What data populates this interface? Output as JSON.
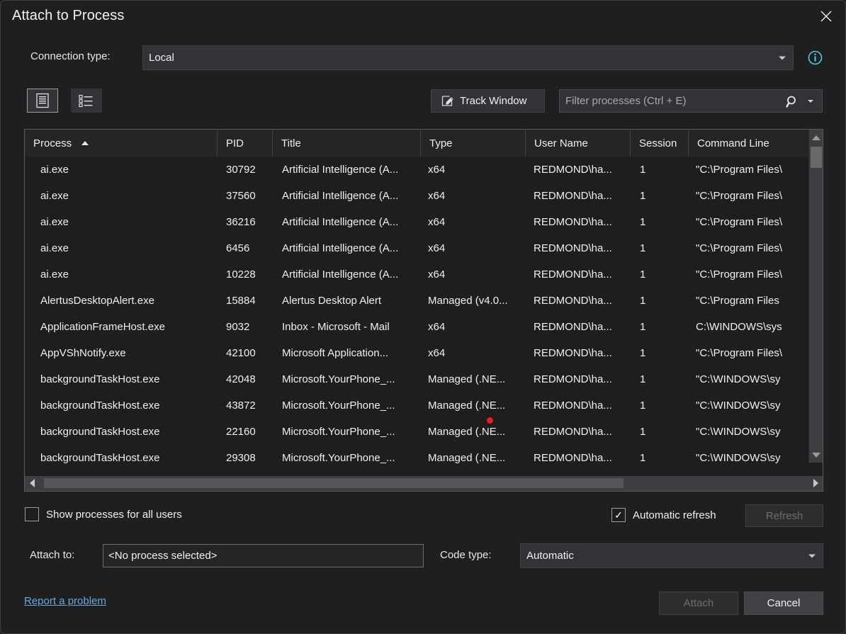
{
  "window": {
    "title": "Attach to Process",
    "close_icon": "close-icon"
  },
  "connection": {
    "label": "Connection type:",
    "value": "Local",
    "info_icon": "info-icon"
  },
  "toolbar": {
    "details_view_icon": "details-view-icon",
    "list_view_icon": "list-view-icon",
    "track_window_label": "Track Window",
    "track_window_icon": "track-window-icon",
    "filter_placeholder": "Filter processes (Ctrl + E)",
    "filter_value": "",
    "search_icon": "search-icon",
    "filter_dropdown_icon": "chevron-down-icon"
  },
  "grid": {
    "columns": [
      {
        "label": "Process",
        "sorted": "asc"
      },
      {
        "label": "PID",
        "sorted": ""
      },
      {
        "label": "Title",
        "sorted": ""
      },
      {
        "label": "Type",
        "sorted": ""
      },
      {
        "label": "User Name",
        "sorted": ""
      },
      {
        "label": "Session",
        "sorted": ""
      },
      {
        "label": "Command Line",
        "sorted": ""
      }
    ],
    "rows": [
      {
        "process": "ai.exe",
        "pid": "30792",
        "title": "Artificial Intelligence (A...",
        "type": "x64",
        "user": "REDMOND\\ha...",
        "session": "1",
        "cmd": "\"C:\\Program Files\\"
      },
      {
        "process": "ai.exe",
        "pid": "37560",
        "title": "Artificial Intelligence (A...",
        "type": "x64",
        "user": "REDMOND\\ha...",
        "session": "1",
        "cmd": "\"C:\\Program Files\\"
      },
      {
        "process": "ai.exe",
        "pid": "36216",
        "title": "Artificial Intelligence (A...",
        "type": "x64",
        "user": "REDMOND\\ha...",
        "session": "1",
        "cmd": "\"C:\\Program Files\\"
      },
      {
        "process": "ai.exe",
        "pid": "6456",
        "title": "Artificial Intelligence (A...",
        "type": "x64",
        "user": "REDMOND\\ha...",
        "session": "1",
        "cmd": "\"C:\\Program Files\\"
      },
      {
        "process": "ai.exe",
        "pid": "10228",
        "title": "Artificial Intelligence (A...",
        "type": "x64",
        "user": "REDMOND\\ha...",
        "session": "1",
        "cmd": "\"C:\\Program Files\\"
      },
      {
        "process": "AlertusDesktopAlert.exe",
        "pid": "15884",
        "title": "Alertus Desktop Alert",
        "type": "Managed (v4.0...",
        "user": "REDMOND\\ha...",
        "session": "1",
        "cmd": "\"C:\\Program Files"
      },
      {
        "process": "ApplicationFrameHost.exe",
        "pid": "9032",
        "title": "Inbox - Microsoft - Mail",
        "type": "x64",
        "user": "REDMOND\\ha...",
        "session": "1",
        "cmd": "C:\\WINDOWS\\sys"
      },
      {
        "process": "AppVShNotify.exe",
        "pid": "42100",
        "title": "Microsoft Application...",
        "type": "x64",
        "user": "REDMOND\\ha...",
        "session": "1",
        "cmd": "\"C:\\Program Files\\"
      },
      {
        "process": "backgroundTaskHost.exe",
        "pid": "42048",
        "title": "Microsoft.YourPhone_...",
        "type": "Managed (.NE...",
        "user": "REDMOND\\ha...",
        "session": "1",
        "cmd": "\"C:\\WINDOWS\\sy"
      },
      {
        "process": "backgroundTaskHost.exe",
        "pid": "43872",
        "title": "Microsoft.YourPhone_...",
        "type": "Managed (.NE...",
        "user": "REDMOND\\ha...",
        "session": "1",
        "cmd": "\"C:\\WINDOWS\\sy"
      },
      {
        "process": "backgroundTaskHost.exe",
        "pid": "22160",
        "title": "Microsoft.YourPhone_...",
        "type": "Managed (.NE...",
        "user": "REDMOND\\ha...",
        "session": "1",
        "cmd": "\"C:\\WINDOWS\\sy"
      },
      {
        "process": "backgroundTaskHost.exe",
        "pid": "29308",
        "title": "Microsoft.YourPhone_...",
        "type": "Managed (.NE...",
        "user": "REDMOND\\ha...",
        "session": "1",
        "cmd": "\"C:\\WINDOWS\\sy"
      }
    ],
    "vscroll_up_icon": "scroll-up-icon",
    "vscroll_down_icon": "scroll-down-icon",
    "hscroll_left_icon": "scroll-left-icon",
    "hscroll_right_icon": "scroll-right-icon"
  },
  "options": {
    "show_all_users_label": "Show processes for all users",
    "show_all_users_checked": false,
    "show_all_users_mark": "",
    "automatic_refresh_label": "Automatic refresh",
    "automatic_refresh_checked": true,
    "automatic_refresh_mark": "✓",
    "refresh_label": "Refresh"
  },
  "attach": {
    "label": "Attach to:",
    "value": "<No process selected>",
    "code_type_label": "Code type:",
    "code_type_value": "Automatic",
    "code_type_dropdown_icon": "chevron-down-icon"
  },
  "footer": {
    "report_link": "Report a problem",
    "attach_label": "Attach",
    "cancel_label": "Cancel"
  },
  "colors": {
    "dialog_bg": "#1f1f1f",
    "field_bg": "#333337",
    "link": "#68a8dd",
    "info": "#4ec9e8",
    "cursor_dot": "#e02020"
  }
}
